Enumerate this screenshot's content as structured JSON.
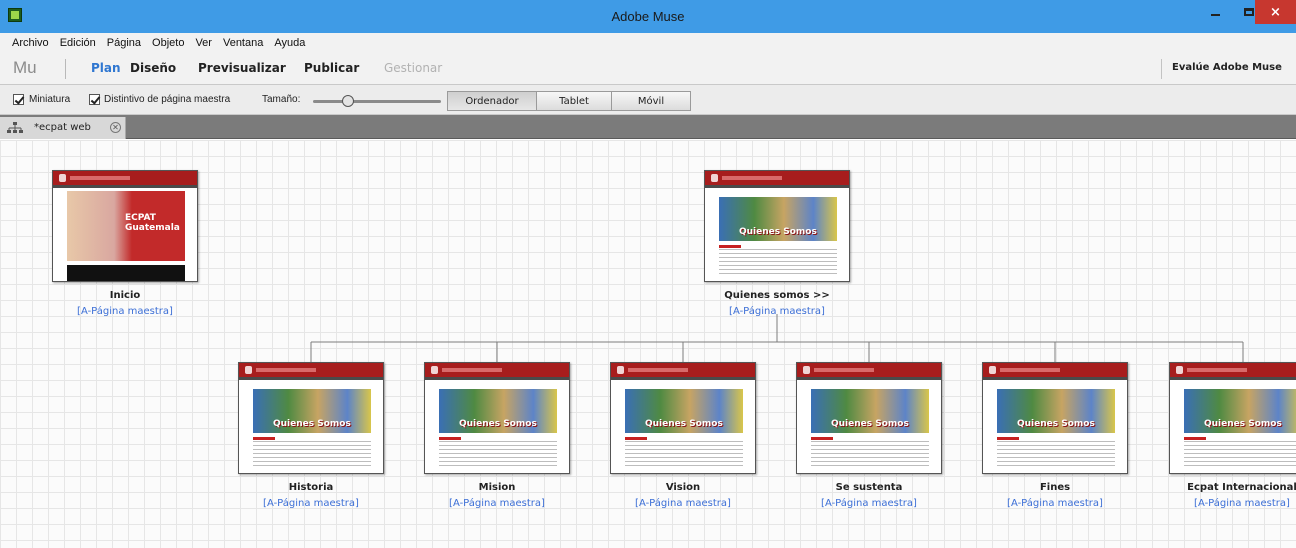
{
  "window": {
    "title": "Adobe Muse",
    "close_glyph": "×"
  },
  "menu": [
    "Archivo",
    "Edición",
    "Página",
    "Objeto",
    "Ver",
    "Ventana",
    "Ayuda"
  ],
  "workflow": {
    "logo": "Mu",
    "tabs": [
      {
        "label": "Plan",
        "state": "active"
      },
      {
        "label": "Diseño",
        "state": "normal"
      },
      {
        "label": "Previsualizar",
        "state": "normal"
      },
      {
        "label": "Publicar",
        "state": "normal"
      },
      {
        "label": "Gestionar",
        "state": "disabled"
      }
    ],
    "evaluate_label": "Evalúe Adobe Muse"
  },
  "options": {
    "thumbnail_label": "Miniatura",
    "thumbnail_checked": true,
    "master_badge_label": "Distintivo de página maestra",
    "master_badge_checked": true,
    "size_label": "Tamaño:",
    "size_level": 0.27,
    "layouts": [
      {
        "label": "Ordenador",
        "active": true
      },
      {
        "label": "Tablet",
        "active": false
      },
      {
        "label": "Móvil",
        "active": false
      }
    ]
  },
  "document_tab": {
    "label": "*ecpat web",
    "close_glyph": "✕",
    "icon": "sitemap-icon"
  },
  "sitemap": {
    "home": {
      "title": "Inicio",
      "master": "[A-Página maestra]",
      "hero_text": "ECPAT Guatemala"
    },
    "parent": {
      "title": "Quienes somos >>",
      "master": "[A-Página maestra]",
      "photo_label": "Quienes Somos"
    },
    "children": [
      {
        "title": "Historia",
        "master": "[A-Página maestra]",
        "photo_label": "Quienes Somos"
      },
      {
        "title": "Mision",
        "master": "[A-Página maestra]",
        "photo_label": "Quienes Somos"
      },
      {
        "title": "Vision",
        "master": "[A-Página maestra]",
        "photo_label": "Quienes Somos"
      },
      {
        "title": "Se sustenta",
        "master": "[A-Página maestra]",
        "photo_label": "Quienes Somos"
      },
      {
        "title": "Fines",
        "master": "[A-Página maestra]",
        "photo_label": "Quienes Somos"
      },
      {
        "title": "Ecpat Internacional",
        "master": "[A-Página maestra]",
        "photo_label": "Quienes Somos"
      }
    ]
  },
  "colors": {
    "link": "#3c6fd6",
    "accent": "#2f77d1",
    "titlebar": "#3f9be6",
    "close": "#c7372f",
    "thumb_header": "#a71d1d"
  }
}
